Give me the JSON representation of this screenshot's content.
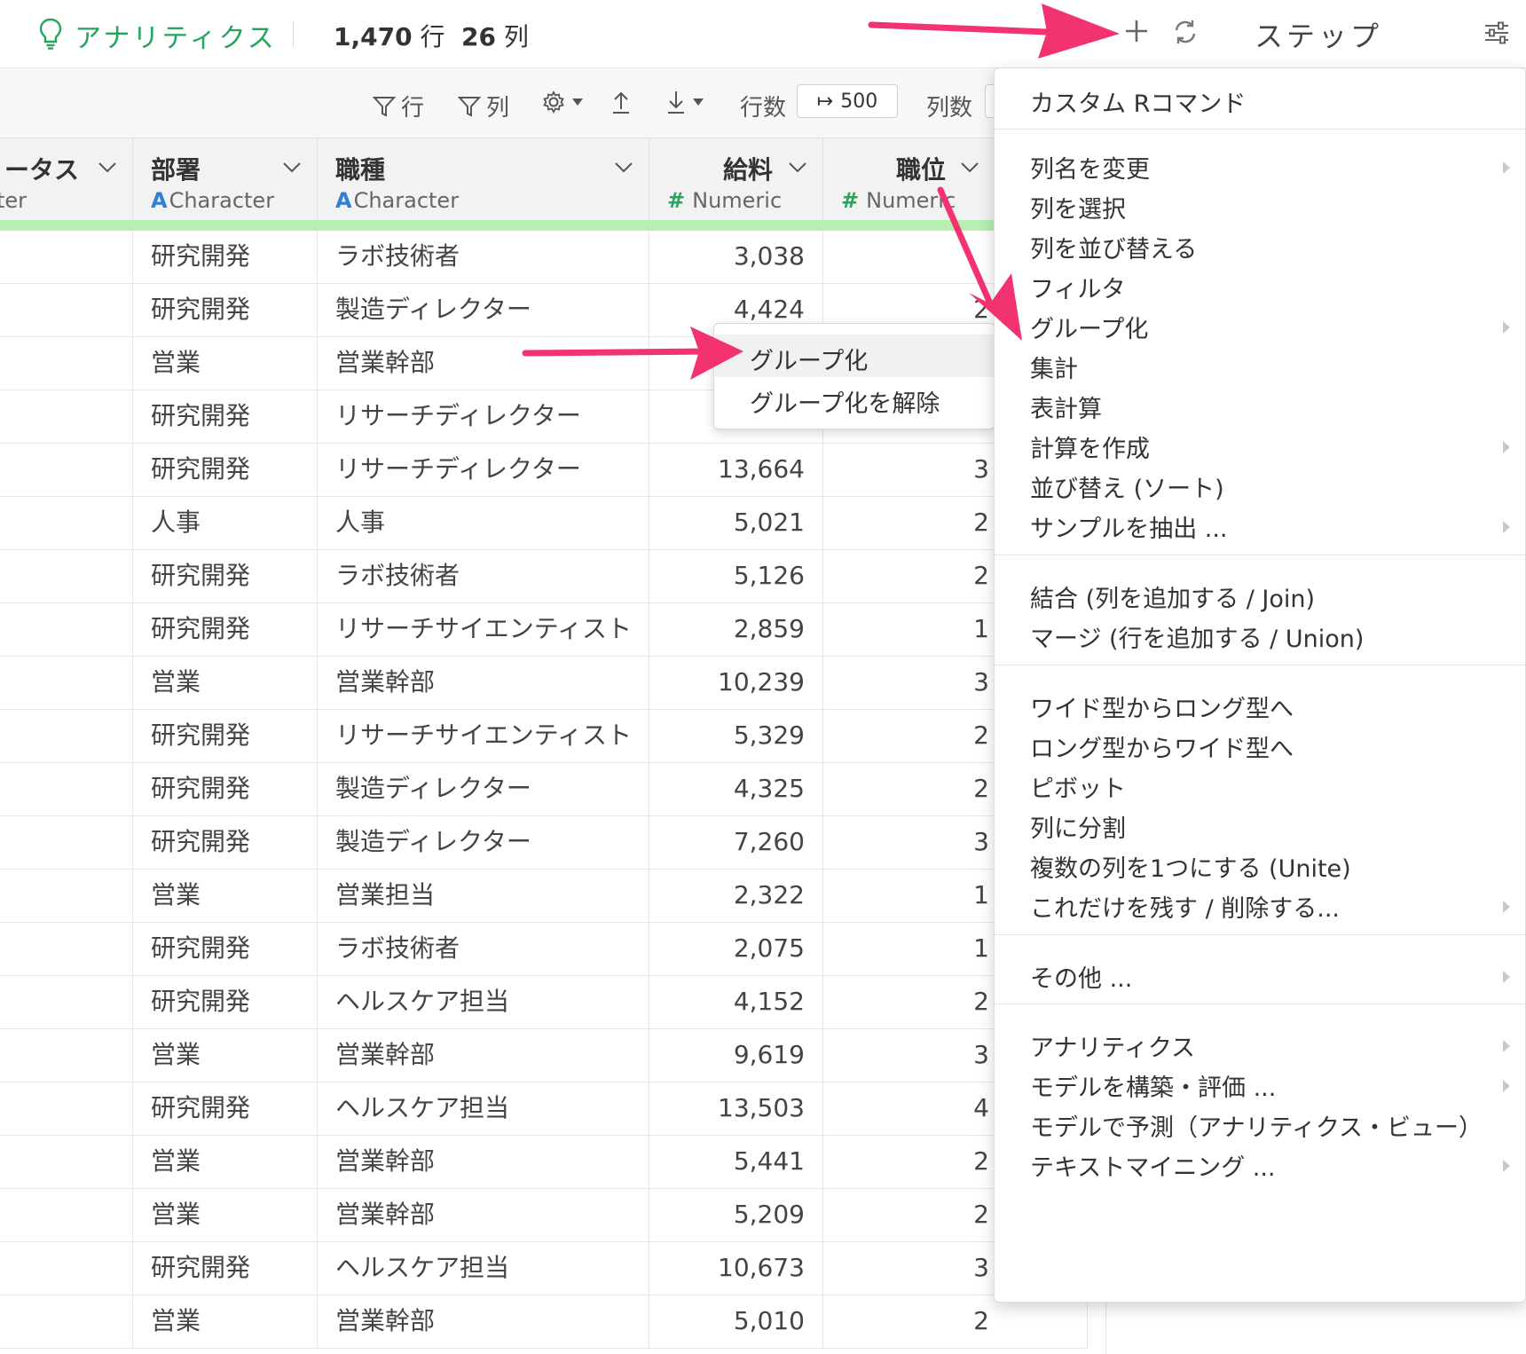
{
  "header": {
    "app_title": "アナリティクス",
    "row_count_num": "1,470",
    "row_count_unit": "行",
    "col_count_num": "26",
    "col_count_unit": "列",
    "step_title": "ステップ"
  },
  "toolbar": {
    "filter_rows": "行",
    "filter_cols": "列",
    "rows_label": "行数",
    "rows_value": "500",
    "cols_label": "列数"
  },
  "columns": [
    {
      "name": "ステータス",
      "visible_name": "ータス",
      "type_prefix": "",
      "type": "ter"
    },
    {
      "name": "部署",
      "type_prefix": "A",
      "type": "Character"
    },
    {
      "name": "職種",
      "type_prefix": "A",
      "type": "Character"
    },
    {
      "name": "給料",
      "type_prefix": "#",
      "type": "Numeric"
    },
    {
      "name": "職位",
      "type_prefix": "#",
      "type": "Numeric"
    }
  ],
  "rows": [
    {
      "dept": "研究開発",
      "job": "ラボ技術者",
      "salary": "3,038",
      "level": ""
    },
    {
      "dept": "研究開発",
      "job": "製造ディレクター",
      "salary": "4,424",
      "level": "2"
    },
    {
      "dept": "営業",
      "job": "営業幹部",
      "salary": "",
      "level": ""
    },
    {
      "dept": "研究開発",
      "job": "リサーチディレクター",
      "salary": "",
      "level": ""
    },
    {
      "dept": "研究開発",
      "job": "リサーチディレクター",
      "salary": "13,664",
      "level": "3"
    },
    {
      "dept": "人事",
      "job": "人事",
      "salary": "5,021",
      "level": "2"
    },
    {
      "dept": "研究開発",
      "job": "ラボ技術者",
      "salary": "5,126",
      "level": "2"
    },
    {
      "dept": "研究開発",
      "job": "リサーチサイエンティスト",
      "salary": "2,859",
      "level": "1"
    },
    {
      "dept": "営業",
      "job": "営業幹部",
      "salary": "10,239",
      "level": "3"
    },
    {
      "dept": "研究開発",
      "job": "リサーチサイエンティスト",
      "salary": "5,329",
      "level": "2"
    },
    {
      "dept": "研究開発",
      "job": "製造ディレクター",
      "salary": "4,325",
      "level": "2"
    },
    {
      "dept": "研究開発",
      "job": "製造ディレクター",
      "salary": "7,260",
      "level": "3"
    },
    {
      "dept": "営業",
      "job": "営業担当",
      "salary": "2,322",
      "level": "1"
    },
    {
      "dept": "研究開発",
      "job": "ラボ技術者",
      "salary": "2,075",
      "level": "1"
    },
    {
      "dept": "研究開発",
      "job": "ヘルスケア担当",
      "salary": "4,152",
      "level": "2"
    },
    {
      "dept": "営業",
      "job": "営業幹部",
      "salary": "9,619",
      "level": "3"
    },
    {
      "dept": "研究開発",
      "job": "ヘルスケア担当",
      "salary": "13,503",
      "level": "4"
    },
    {
      "dept": "営業",
      "job": "営業幹部",
      "salary": "5,441",
      "level": "2"
    },
    {
      "dept": "営業",
      "job": "営業幹部",
      "salary": "5,209",
      "level": "2"
    },
    {
      "dept": "研究開発",
      "job": "ヘルスケア担当",
      "salary": "10,673",
      "level": "3"
    },
    {
      "dept": "営業",
      "job": "営業幹部",
      "salary": "5,010",
      "level": "2"
    }
  ],
  "menu": {
    "items": [
      {
        "label": "カスタム Rコマンド",
        "submenu": false
      },
      {
        "label": "列名を変更",
        "submenu": true
      },
      {
        "label": "列を選択",
        "submenu": false
      },
      {
        "label": "列を並び替える",
        "submenu": false
      },
      {
        "label": "フィルタ",
        "submenu": false
      },
      {
        "label": "グループ化",
        "submenu": true
      },
      {
        "label": "集計",
        "submenu": false
      },
      {
        "label": "表計算",
        "submenu": false
      },
      {
        "label": "計算を作成",
        "submenu": true
      },
      {
        "label": "並び替え (ソート)",
        "submenu": false
      },
      {
        "label": "サンプルを抽出 ...",
        "submenu": true
      },
      {
        "label": "結合 (列を追加する / Join)",
        "submenu": false
      },
      {
        "label": "マージ (行を追加する / Union)",
        "submenu": false
      },
      {
        "label": "ワイド型からロング型へ",
        "submenu": false
      },
      {
        "label": "ロング型からワイド型へ",
        "submenu": false
      },
      {
        "label": "ピボット",
        "submenu": false
      },
      {
        "label": "列に分割",
        "submenu": false
      },
      {
        "label": "複数の列を1つにする (Unite)",
        "submenu": false
      },
      {
        "label": "これだけを残す / 削除する...",
        "submenu": true
      },
      {
        "label": "その他 ...",
        "submenu": true
      },
      {
        "label": "アナリティクス",
        "submenu": true
      },
      {
        "label": "モデルを構築・評価 ...",
        "submenu": true
      },
      {
        "label": "モデルで予測（アナリティクス・ビュー）",
        "submenu": false
      },
      {
        "label": "テキストマイニング ...",
        "submenu": true
      }
    ]
  },
  "submenu": {
    "items": [
      {
        "label": "グループ化",
        "highlighted": true
      },
      {
        "label": "グループ化を解除",
        "highlighted": false
      }
    ]
  },
  "colors": {
    "accent_green": "#23a55a",
    "type_character_blue": "#2f7fd3",
    "header_green_bar": "#b6efb1",
    "annotation_arrow": "#f2336f"
  },
  "icons": [
    "lightbulb-icon",
    "plus-icon",
    "refresh-icon",
    "settings-sliders-icon",
    "filter-icon",
    "gear-icon",
    "upload-icon",
    "download-icon",
    "chevron-down-icon",
    "chevron-right-icon"
  ]
}
